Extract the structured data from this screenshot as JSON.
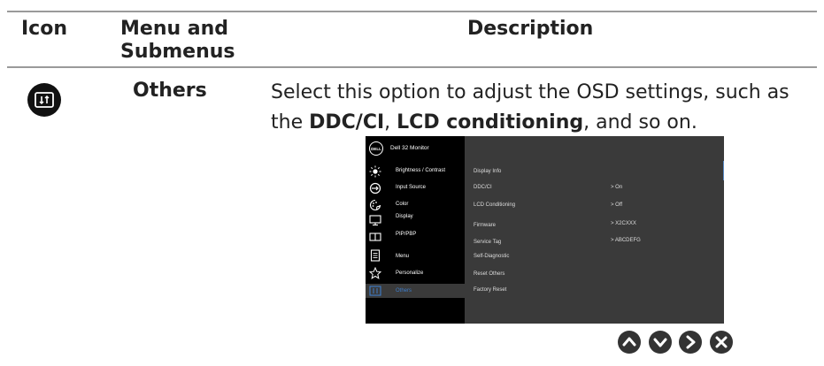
{
  "table": {
    "headers": {
      "icon": "Icon",
      "menu": "Menu and Submenus",
      "description": "Description"
    },
    "row": {
      "menu_label": "Others",
      "desc_part1": "Select this option to adjust the OSD settings, such as the ",
      "desc_bold1": "DDC/CI",
      "desc_part2": ", ",
      "desc_bold2": "LCD conditioning",
      "desc_part3": ", and so on."
    }
  },
  "osd": {
    "logo": "DELL",
    "title": "Dell 32 Monitor",
    "menu": [
      {
        "label": "Brightness / Contrast",
        "icon": "brightness-icon"
      },
      {
        "label": "Input Source",
        "icon": "input-source-icon"
      },
      {
        "label": "Color",
        "icon": "color-icon"
      },
      {
        "label": "Display",
        "icon": "display-icon"
      },
      {
        "label": "PIP/PBP",
        "icon": "pip-pbp-icon"
      },
      {
        "label": "Menu",
        "icon": "menu-icon"
      },
      {
        "label": "Personalize",
        "icon": "personalize-icon"
      },
      {
        "label": "Others",
        "icon": "others-icon",
        "selected": true
      }
    ],
    "options": [
      {
        "label": "Display Info",
        "value": ""
      },
      {
        "label": "DDC/CI",
        "value": ">  On"
      },
      {
        "label": "LCD Conditioning",
        "value": ">  Off"
      },
      {
        "label": "Firmware",
        "value": ">  X2CXXX"
      },
      {
        "label": "Service Tag",
        "value": ">  ABCDEFG"
      },
      {
        "label": "Self-Diagnostic",
        "value": ""
      },
      {
        "label": "Reset Others",
        "value": ""
      },
      {
        "label": "Factory Reset",
        "value": ""
      }
    ]
  },
  "navigation_buttons": [
    "up-icon",
    "down-icon",
    "right-icon",
    "close-icon"
  ],
  "colors": {
    "accent": "#3d7cc9",
    "rule": "#9a9a9a",
    "osd_bg": "#3a3a3a"
  }
}
